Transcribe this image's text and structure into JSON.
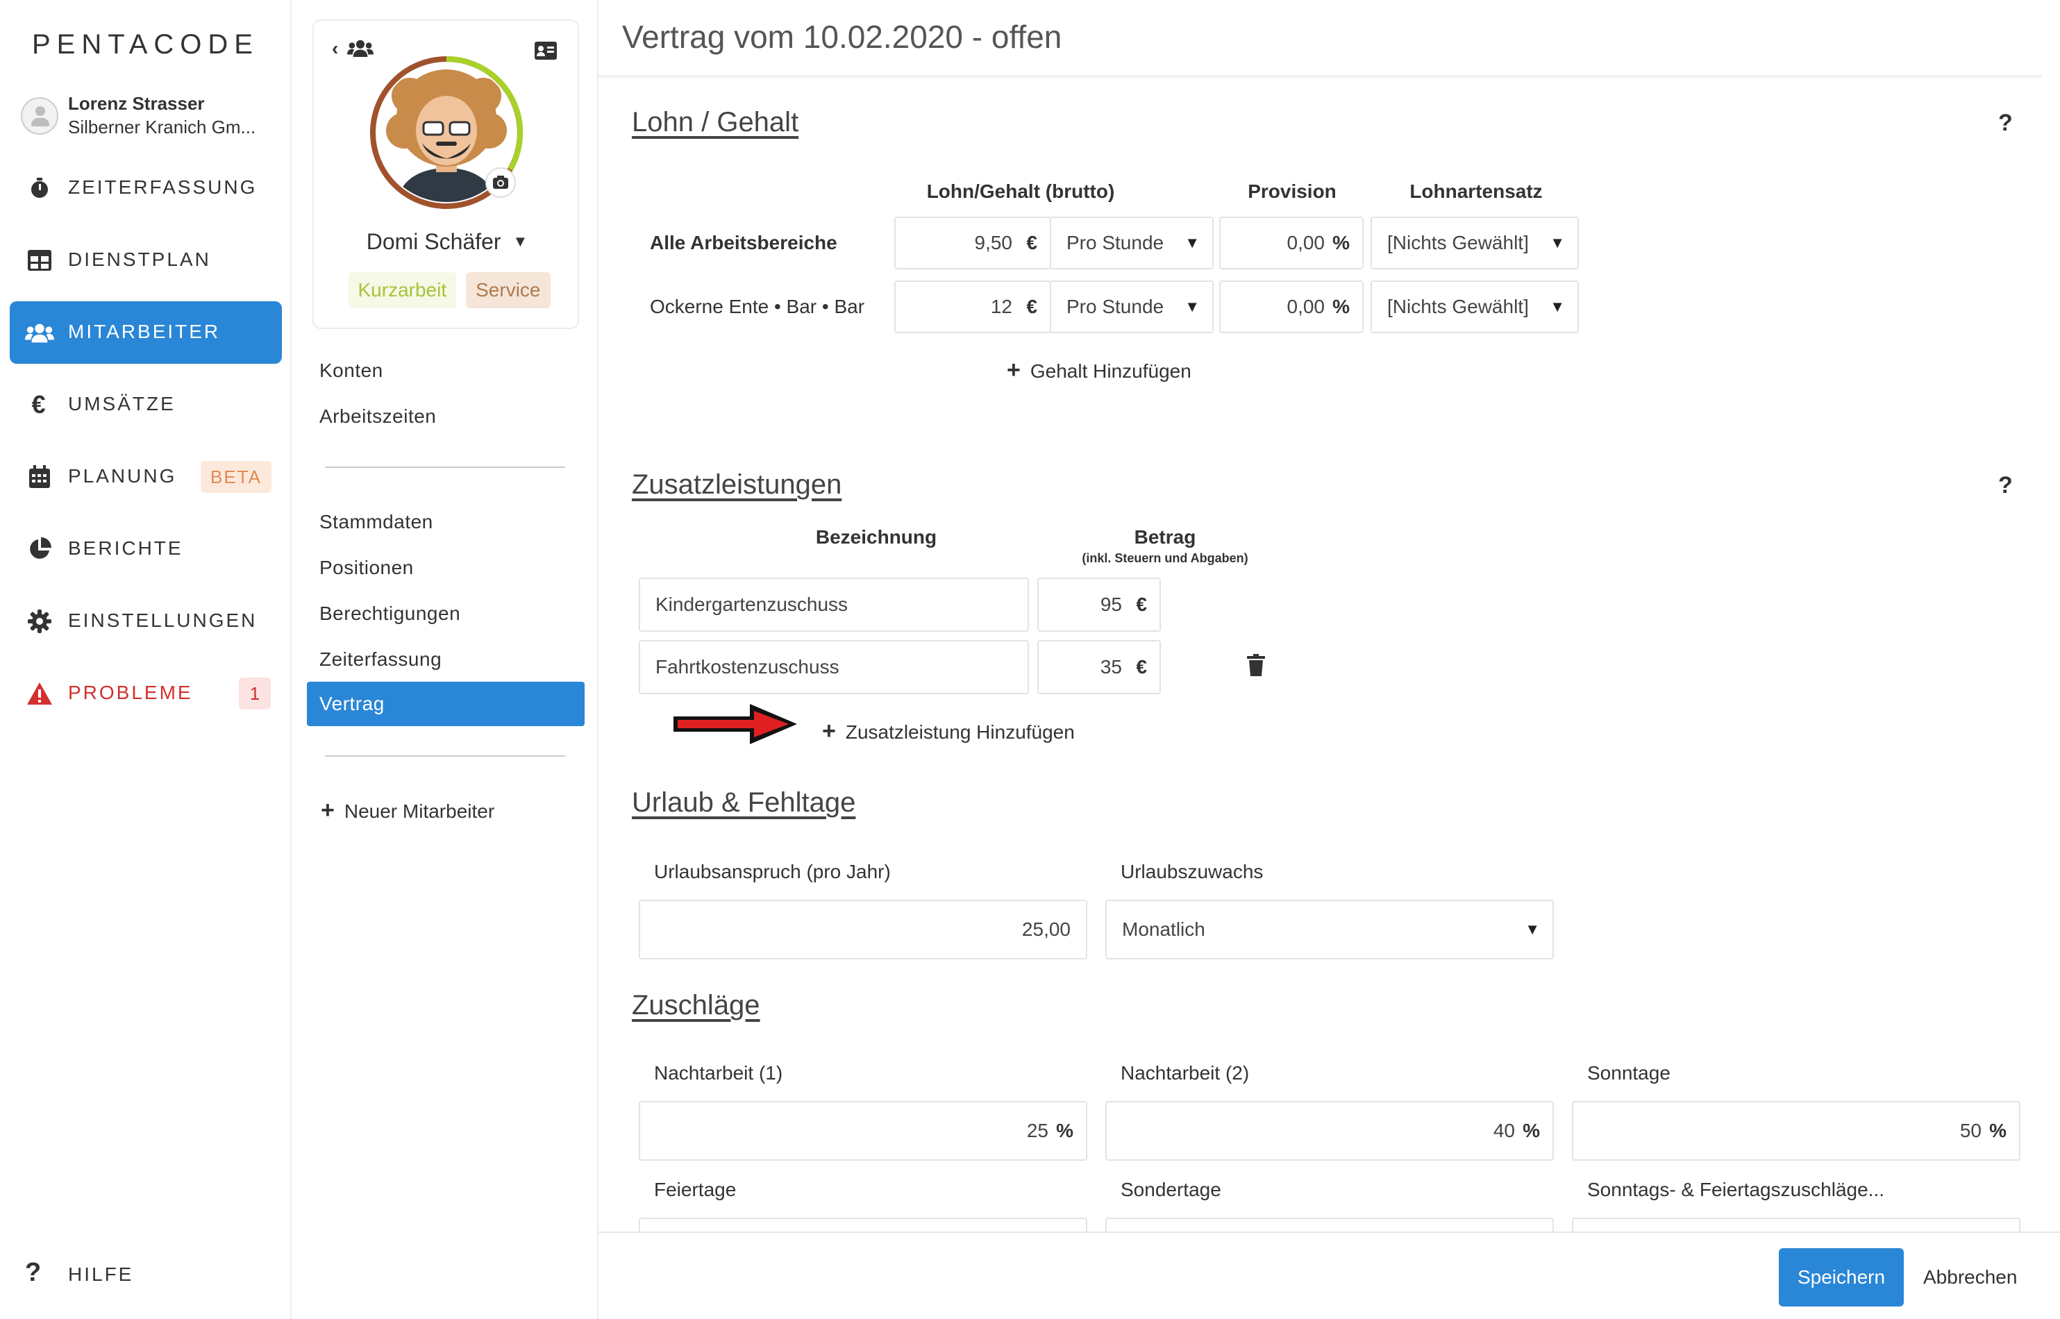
{
  "app": {
    "logo": "PENTACODE"
  },
  "user": {
    "name": "Lorenz Strasser",
    "company": "Silberner Kranich Gm..."
  },
  "nav": {
    "items": [
      {
        "label": "ZEITERFASSUNG",
        "icon": "stopwatch-icon"
      },
      {
        "label": "DIENSTPLAN",
        "icon": "table-icon"
      },
      {
        "label": "MITARBEITER",
        "icon": "users-icon",
        "active": true
      },
      {
        "label": "UMSÄTZE",
        "icon": "euro-icon"
      },
      {
        "label": "PLANUNG",
        "icon": "calendar-icon",
        "badge": "BETA"
      },
      {
        "label": "BERICHTE",
        "icon": "pie-chart-icon"
      },
      {
        "label": "EINSTELLUNGEN",
        "icon": "gear-icon"
      },
      {
        "label": "PROBLEME",
        "icon": "warning-icon",
        "badge": "1"
      }
    ],
    "help": "HILFE"
  },
  "employee": {
    "name": "Domi Schäfer",
    "tags": [
      "Kurzarbeit",
      "Service"
    ]
  },
  "subnav": {
    "group1": [
      "Konten",
      "Arbeitszeiten"
    ],
    "group2": [
      "Stammdaten",
      "Positionen",
      "Berechtigungen",
      "Zeiterfassung",
      "Vertrag"
    ],
    "active": "Vertrag",
    "new_employee": "Neuer Mitarbeiter"
  },
  "page": {
    "title": "Vertrag vom 10.02.2020 - offen"
  },
  "lohn": {
    "title": "Lohn / Gehalt",
    "help": "?",
    "headers": {
      "gehalt": "Lohn/Gehalt (brutto)",
      "provision": "Provision",
      "lohnart": "Lohnartensatz"
    },
    "rows": [
      {
        "label": "Alle Arbeitsbereiche",
        "amount": "9,50",
        "currency": "€",
        "period": "Pro Stunde",
        "provision": "0,00",
        "percent": "%",
        "lohnart": "[Nichts Gewählt]"
      },
      {
        "label": "Ockerne Ente • Bar • Bar",
        "amount": "12",
        "currency": "€",
        "period": "Pro Stunde",
        "provision": "0,00",
        "percent": "%",
        "lohnart": "[Nichts Gewählt]"
      }
    ],
    "add": "Gehalt Hinzufügen"
  },
  "zusatz": {
    "title": "Zusatzleistungen",
    "help": "?",
    "headers": {
      "name": "Bezeichnung",
      "amount": "Betrag",
      "amount_note": "(inkl. Steuern und Abgaben)"
    },
    "rows": [
      {
        "name": "Kindergartenzuschuss",
        "amount": "95",
        "currency": "€"
      },
      {
        "name": "Fahrtkostenzuschuss",
        "amount": "35",
        "currency": "€"
      }
    ],
    "add": "Zusatzleistung Hinzufügen"
  },
  "urlaub": {
    "title": "Urlaub & Fehltage",
    "anspruch_label": "Urlaubsanspruch (pro Jahr)",
    "anspruch_value": "25,00",
    "zuwachs_label": "Urlaubszuwachs",
    "zuwachs_value": "Monatlich"
  },
  "zuschlaege": {
    "title": "Zuschläge",
    "fields": [
      {
        "label": "Nachtarbeit (1)",
        "value": "25",
        "unit": "%"
      },
      {
        "label": "Nachtarbeit (2)",
        "value": "40",
        "unit": "%"
      },
      {
        "label": "Sonntage",
        "value": "50",
        "unit": "%"
      }
    ],
    "row2_labels": [
      "Feiertage",
      "Sondertage",
      "Sonntags- & Feiertagszuschläge..."
    ]
  },
  "footer": {
    "save": "Speichern",
    "cancel": "Abbrechen"
  },
  "colors": {
    "primary": "#2a86d6",
    "problem": "#d32f2f",
    "beta_bg": "#fde9dc",
    "kurzarbeit": "#a8c23a",
    "service": "#b07a4f",
    "arrow": "#e02020"
  }
}
